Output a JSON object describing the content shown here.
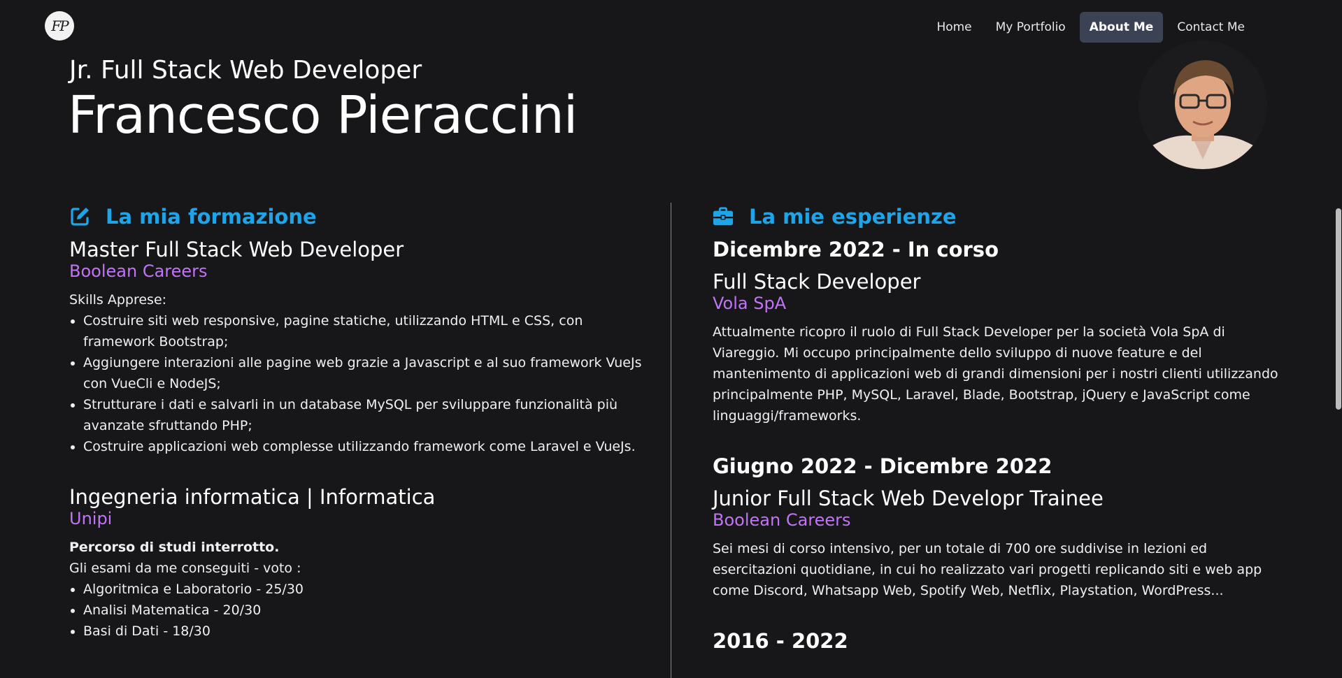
{
  "logo": {
    "text": "FP"
  },
  "nav": {
    "items": [
      {
        "label": "Home",
        "active": false
      },
      {
        "label": "My Portfolio",
        "active": false
      },
      {
        "label": "About Me",
        "active": true
      },
      {
        "label": "Contact Me",
        "active": false
      }
    ]
  },
  "hero": {
    "subtitle": "Jr. Full Stack Web Developer",
    "name": "Francesco Pieraccini"
  },
  "education": {
    "title": "La mia formazione",
    "icon": "edit-icon",
    "entries": [
      {
        "title": "Master Full Stack Web Developer",
        "institution": "Boolean Careers",
        "intro": "Skills Apprese:",
        "items": [
          "Costruire siti web responsive, pagine statiche, utilizzando HTML e CSS, con framework Bootstrap;",
          "Aggiungere interazioni alle pagine web grazie a Javascript e al suo framework VueJs con VueCli e NodeJS;",
          "Strutturare i dati e salvarli in un database MySQL per sviluppare funzionalità più avanzate sfruttando PHP;",
          "Costruire applicazioni web complesse utilizzando framework come Laravel e VueJs."
        ]
      },
      {
        "title": "Ingegneria informatica | Informatica",
        "institution": "Unipi",
        "note": "Percorso di studi interrotto.",
        "intro": "Gli esami da me conseguiti - voto :",
        "items": [
          "Algoritmica e Laboratorio - 25/30",
          "Analisi Matematica - 20/30",
          "Basi di Dati - 18/30"
        ]
      }
    ]
  },
  "experience": {
    "title": "La mie esperienze",
    "icon": "briefcase-icon",
    "entries": [
      {
        "period": "Dicembre 2022 - In corso",
        "role": "Full Stack Developer",
        "company": "Vola SpA",
        "description": "Attualmente ricopro il ruolo di Full Stack Developer per la società Vola SpA di Viareggio. Mi occupo principalmente dello sviluppo di nuove feature e del mantenimento di applicazioni web di grandi dimensioni per i nostri clienti utilizzando principalmente PHP, MySQL, Laravel, Blade, Bootstrap, jQuery e JavaScript come linguaggi/frameworks."
      },
      {
        "period": "Giugno 2022 - Dicembre 2022",
        "role": "Junior Full Stack Web Developr Trainee",
        "company": "Boolean Careers",
        "description": "Sei mesi di corso intensivo, per un totale di 700 ore suddivise in lezioni ed esercitazioni quotidiane, in cui ho realizzato vari progetti replicando siti e web app come Discord, Whatsapp Web, Spotify Web, Netflix, Playstation, WordPress..."
      },
      {
        "period": "2016 - 2022"
      }
    ]
  },
  "colors": {
    "background": "#17171a",
    "accent_blue": "#20a4e8",
    "accent_purple": "#c174f5",
    "nav_active": "#3b4253"
  }
}
